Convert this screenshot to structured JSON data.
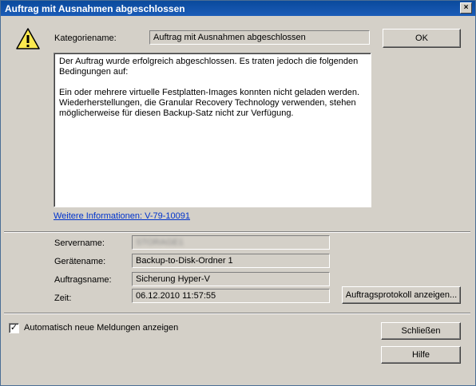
{
  "window": {
    "title": "Auftrag mit Ausnahmen abgeschlossen",
    "close_glyph": "×"
  },
  "category": {
    "label": "Kategoriename:",
    "value": "Auftrag mit Ausnahmen abgeschlossen"
  },
  "message": {
    "paragraph1": "Der Auftrag wurde erfolgreich abgeschlossen. Es traten jedoch die folgenden Bedingungen auf:",
    "paragraph2": "Ein oder mehrere virtuelle Festplatten-Images konnten nicht geladen werden. Wiederherstellungen, die Granular Recovery Technology verwenden, stehen möglicherweise für diesen Backup-Satz nicht zur Verfügung."
  },
  "more_info_link": "Weitere Informationen: V-79-10091",
  "details": {
    "server": {
      "label": "Servername:",
      "value": "STORAGE1"
    },
    "device": {
      "label": "Gerätename:",
      "value": "Backup-to-Disk-Ordner 1"
    },
    "job": {
      "label": "Auftragsname:",
      "value": "Sicherung Hyper-V"
    },
    "time": {
      "label": "Zeit:",
      "value": "06.12.2010 11:57:55"
    }
  },
  "buttons": {
    "ok": "OK",
    "show_log": "Auftragsprotokoll anzeigen...",
    "close": "Schließen",
    "help": "Hilfe"
  },
  "auto_show": {
    "label": "Automatisch neue Meldungen anzeigen",
    "checked": true,
    "check_glyph": "✓"
  }
}
